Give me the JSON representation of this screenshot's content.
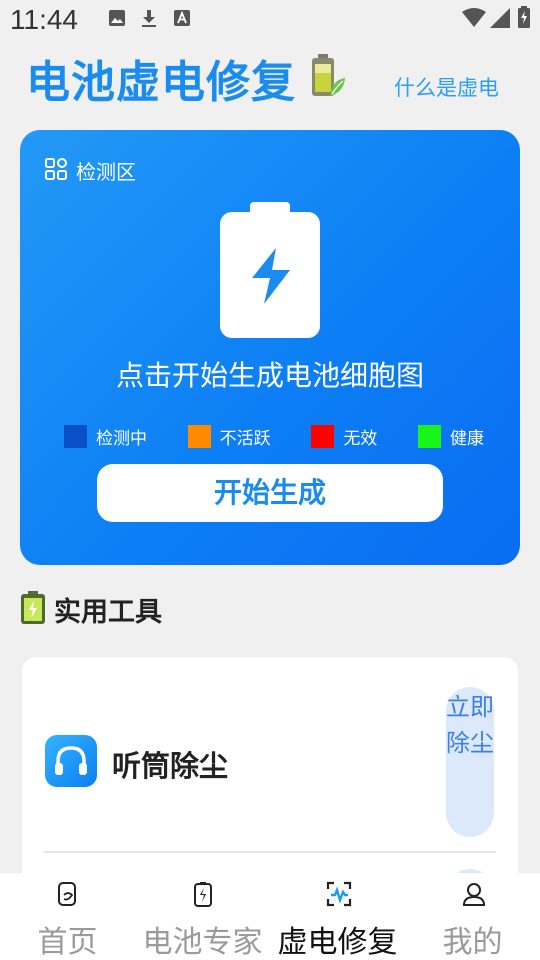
{
  "status_bar": {
    "time": "11:44",
    "left_icons": [
      "image-icon",
      "download-icon",
      "a-box-icon"
    ],
    "right_icons": [
      "wifi-icon",
      "signal-icon",
      "battery-icon"
    ]
  },
  "header": {
    "title": "电池虚电修复",
    "help_link": "什么是虚电"
  },
  "detect_card": {
    "label": "检测区",
    "prompt": "点击开始生成电池细胞图",
    "legend": [
      {
        "label": "检测中",
        "color": "#0a4fc6"
      },
      {
        "label": "不活跃",
        "color": "#ff8a00"
      },
      {
        "label": "无效",
        "color": "#ff0000"
      },
      {
        "label": "健康",
        "color": "#19f51a"
      }
    ],
    "start_button": "开始生成"
  },
  "tools": {
    "section_title": "实用工具",
    "items": [
      {
        "name": "听筒除尘",
        "action": "立即除尘",
        "icon": "headphones-icon"
      }
    ]
  },
  "bottom_nav": {
    "items": [
      {
        "label": "首页",
        "icon": "home-icon",
        "active": false
      },
      {
        "label": "电池专家",
        "icon": "battery-charge-icon",
        "active": false
      },
      {
        "label": "虚电修复",
        "icon": "scan-repair-icon",
        "active": true
      },
      {
        "label": "我的",
        "icon": "profile-icon",
        "active": false
      }
    ]
  },
  "colors": {
    "accent": "#1a8cf0",
    "card_gradient_start": "#2399f6",
    "card_gradient_end": "#0a6cf2"
  }
}
